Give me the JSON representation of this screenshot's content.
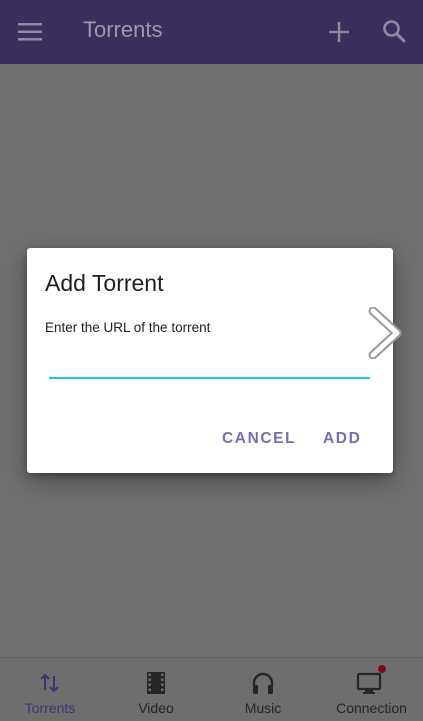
{
  "appbar": {
    "title": "Torrents",
    "icons": [
      "menu-icon",
      "add-icon",
      "search-icon"
    ]
  },
  "dialog": {
    "title": "Add Torrent",
    "message": "Enter the URL of the torrent",
    "input_value": "",
    "cancel_label": "CANCEL",
    "add_label": "ADD"
  },
  "bottom_nav": {
    "items": [
      {
        "label": "Torrents",
        "icon": "sort-arrows-icon",
        "active": true
      },
      {
        "label": "Video",
        "icon": "film-icon",
        "active": false
      },
      {
        "label": "Music",
        "icon": "headphones-icon",
        "active": false
      },
      {
        "label": "Connection",
        "icon": "monitor-icon",
        "active": false,
        "badge": true
      }
    ]
  },
  "colors": {
    "appbar": "#3a2f5c",
    "accent_underline": "#22c9d6",
    "button_text": "#7a6cb3",
    "badge": "#7a0d14"
  }
}
